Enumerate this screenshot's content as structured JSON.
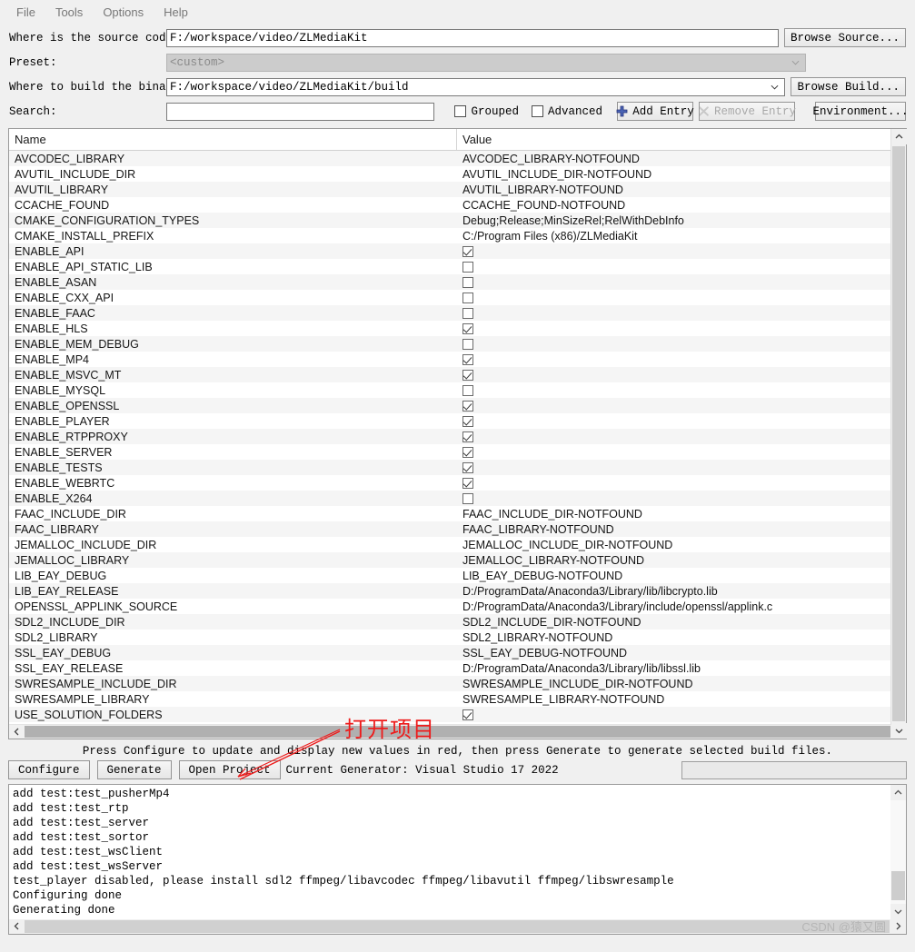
{
  "menubar": {
    "items": [
      {
        "label": "File"
      },
      {
        "label": "Tools"
      },
      {
        "label": "Options"
      },
      {
        "label": "Help"
      }
    ]
  },
  "form": {
    "source_label": "Where is the source code:",
    "source_value": "F:/workspace/video/ZLMediaKit",
    "browse_source_label": "Browse Source...",
    "preset_label": "Preset:",
    "preset_value": "<custom>",
    "build_label": "Where to build the binaries:",
    "build_value": "F:/workspace/video/ZLMediaKit/build",
    "browse_build_label": "Browse Build...",
    "search_label": "Search:",
    "search_value": "",
    "grouped_label": "Grouped",
    "grouped_checked": false,
    "advanced_label": "Advanced",
    "advanced_checked": false,
    "add_entry_label": "Add Entry",
    "remove_entry_label": "Remove Entry",
    "environment_label": "Environment..."
  },
  "table": {
    "columns": [
      "Name",
      "Value"
    ],
    "rows": [
      {
        "name": "AVCODEC_LIBRARY",
        "value": "AVCODEC_LIBRARY-NOTFOUND",
        "type": "text"
      },
      {
        "name": "AVUTIL_INCLUDE_DIR",
        "value": "AVUTIL_INCLUDE_DIR-NOTFOUND",
        "type": "text"
      },
      {
        "name": "AVUTIL_LIBRARY",
        "value": "AVUTIL_LIBRARY-NOTFOUND",
        "type": "text"
      },
      {
        "name": "CCACHE_FOUND",
        "value": "CCACHE_FOUND-NOTFOUND",
        "type": "text"
      },
      {
        "name": "CMAKE_CONFIGURATION_TYPES",
        "value": "Debug;Release;MinSizeRel;RelWithDebInfo",
        "type": "text"
      },
      {
        "name": "CMAKE_INSTALL_PREFIX",
        "value": "C:/Program Files (x86)/ZLMediaKit",
        "type": "text"
      },
      {
        "name": "ENABLE_API",
        "value": true,
        "type": "check"
      },
      {
        "name": "ENABLE_API_STATIC_LIB",
        "value": false,
        "type": "check"
      },
      {
        "name": "ENABLE_ASAN",
        "value": false,
        "type": "check"
      },
      {
        "name": "ENABLE_CXX_API",
        "value": false,
        "type": "check"
      },
      {
        "name": "ENABLE_FAAC",
        "value": false,
        "type": "check"
      },
      {
        "name": "ENABLE_HLS",
        "value": true,
        "type": "check"
      },
      {
        "name": "ENABLE_MEM_DEBUG",
        "value": false,
        "type": "check"
      },
      {
        "name": "ENABLE_MP4",
        "value": true,
        "type": "check"
      },
      {
        "name": "ENABLE_MSVC_MT",
        "value": true,
        "type": "check"
      },
      {
        "name": "ENABLE_MYSQL",
        "value": false,
        "type": "check"
      },
      {
        "name": "ENABLE_OPENSSL",
        "value": true,
        "type": "check"
      },
      {
        "name": "ENABLE_PLAYER",
        "value": true,
        "type": "check"
      },
      {
        "name": "ENABLE_RTPPROXY",
        "value": true,
        "type": "check"
      },
      {
        "name": "ENABLE_SERVER",
        "value": true,
        "type": "check"
      },
      {
        "name": "ENABLE_TESTS",
        "value": true,
        "type": "check"
      },
      {
        "name": "ENABLE_WEBRTC",
        "value": true,
        "type": "check"
      },
      {
        "name": "ENABLE_X264",
        "value": false,
        "type": "check"
      },
      {
        "name": "FAAC_INCLUDE_DIR",
        "value": "FAAC_INCLUDE_DIR-NOTFOUND",
        "type": "text"
      },
      {
        "name": "FAAC_LIBRARY",
        "value": "FAAC_LIBRARY-NOTFOUND",
        "type": "text"
      },
      {
        "name": "JEMALLOC_INCLUDE_DIR",
        "value": "JEMALLOC_INCLUDE_DIR-NOTFOUND",
        "type": "text"
      },
      {
        "name": "JEMALLOC_LIBRARY",
        "value": "JEMALLOC_LIBRARY-NOTFOUND",
        "type": "text"
      },
      {
        "name": "LIB_EAY_DEBUG",
        "value": "LIB_EAY_DEBUG-NOTFOUND",
        "type": "text"
      },
      {
        "name": "LIB_EAY_RELEASE",
        "value": "D:/ProgramData/Anaconda3/Library/lib/libcrypto.lib",
        "type": "text"
      },
      {
        "name": "OPENSSL_APPLINK_SOURCE",
        "value": "D:/ProgramData/Anaconda3/Library/include/openssl/applink.c",
        "type": "text"
      },
      {
        "name": "SDL2_INCLUDE_DIR",
        "value": "SDL2_INCLUDE_DIR-NOTFOUND",
        "type": "text"
      },
      {
        "name": "SDL2_LIBRARY",
        "value": "SDL2_LIBRARY-NOTFOUND",
        "type": "text"
      },
      {
        "name": "SSL_EAY_DEBUG",
        "value": "SSL_EAY_DEBUG-NOTFOUND",
        "type": "text"
      },
      {
        "name": "SSL_EAY_RELEASE",
        "value": "D:/ProgramData/Anaconda3/Library/lib/libssl.lib",
        "type": "text"
      },
      {
        "name": "SWRESAMPLE_INCLUDE_DIR",
        "value": "SWRESAMPLE_INCLUDE_DIR-NOTFOUND",
        "type": "text"
      },
      {
        "name": "SWRESAMPLE_LIBRARY",
        "value": "SWRESAMPLE_LIBRARY-NOTFOUND",
        "type": "text"
      },
      {
        "name": "USE_SOLUTION_FOLDERS",
        "value": true,
        "type": "check"
      }
    ]
  },
  "status": {
    "hint": "Press Configure to update and display new values in red, then press Generate to generate selected build files."
  },
  "actions": {
    "configure_label": "Configure",
    "generate_label": "Generate",
    "open_project_label": "Open Project",
    "generator_label": "Current Generator: Visual Studio 17 2022"
  },
  "log": {
    "lines": [
      "add test:test_pusherMp4",
      "add test:test_rtp",
      "add test:test_server",
      "add test:test_sortor",
      "add test:test_wsClient",
      "add test:test_wsServer",
      "test_player disabled, please install sdl2 ffmpeg/libavcodec ffmpeg/libavutil ffmpeg/libswresample",
      "Configuring done",
      "Generating done"
    ]
  },
  "annotation": {
    "text": "打开项目",
    "color": "#ee1c1c"
  },
  "watermark": {
    "text": "CSDN @猿又圆"
  }
}
